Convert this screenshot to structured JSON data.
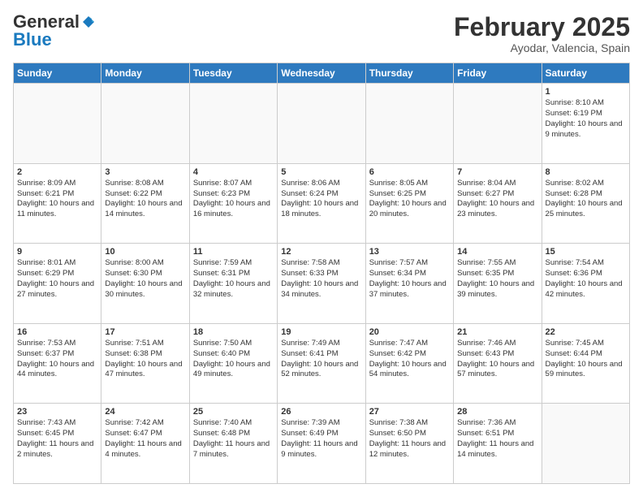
{
  "header": {
    "logo_general": "General",
    "logo_blue": "Blue",
    "month_title": "February 2025",
    "location": "Ayodar, Valencia, Spain"
  },
  "days_of_week": [
    "Sunday",
    "Monday",
    "Tuesday",
    "Wednesday",
    "Thursday",
    "Friday",
    "Saturday"
  ],
  "weeks": [
    [
      {
        "day": "",
        "info": ""
      },
      {
        "day": "",
        "info": ""
      },
      {
        "day": "",
        "info": ""
      },
      {
        "day": "",
        "info": ""
      },
      {
        "day": "",
        "info": ""
      },
      {
        "day": "",
        "info": ""
      },
      {
        "day": "1",
        "info": "Sunrise: 8:10 AM\nSunset: 6:19 PM\nDaylight: 10 hours and 9 minutes."
      }
    ],
    [
      {
        "day": "2",
        "info": "Sunrise: 8:09 AM\nSunset: 6:21 PM\nDaylight: 10 hours and 11 minutes."
      },
      {
        "day": "3",
        "info": "Sunrise: 8:08 AM\nSunset: 6:22 PM\nDaylight: 10 hours and 14 minutes."
      },
      {
        "day": "4",
        "info": "Sunrise: 8:07 AM\nSunset: 6:23 PM\nDaylight: 10 hours and 16 minutes."
      },
      {
        "day": "5",
        "info": "Sunrise: 8:06 AM\nSunset: 6:24 PM\nDaylight: 10 hours and 18 minutes."
      },
      {
        "day": "6",
        "info": "Sunrise: 8:05 AM\nSunset: 6:25 PM\nDaylight: 10 hours and 20 minutes."
      },
      {
        "day": "7",
        "info": "Sunrise: 8:04 AM\nSunset: 6:27 PM\nDaylight: 10 hours and 23 minutes."
      },
      {
        "day": "8",
        "info": "Sunrise: 8:02 AM\nSunset: 6:28 PM\nDaylight: 10 hours and 25 minutes."
      }
    ],
    [
      {
        "day": "9",
        "info": "Sunrise: 8:01 AM\nSunset: 6:29 PM\nDaylight: 10 hours and 27 minutes."
      },
      {
        "day": "10",
        "info": "Sunrise: 8:00 AM\nSunset: 6:30 PM\nDaylight: 10 hours and 30 minutes."
      },
      {
        "day": "11",
        "info": "Sunrise: 7:59 AM\nSunset: 6:31 PM\nDaylight: 10 hours and 32 minutes."
      },
      {
        "day": "12",
        "info": "Sunrise: 7:58 AM\nSunset: 6:33 PM\nDaylight: 10 hours and 34 minutes."
      },
      {
        "day": "13",
        "info": "Sunrise: 7:57 AM\nSunset: 6:34 PM\nDaylight: 10 hours and 37 minutes."
      },
      {
        "day": "14",
        "info": "Sunrise: 7:55 AM\nSunset: 6:35 PM\nDaylight: 10 hours and 39 minutes."
      },
      {
        "day": "15",
        "info": "Sunrise: 7:54 AM\nSunset: 6:36 PM\nDaylight: 10 hours and 42 minutes."
      }
    ],
    [
      {
        "day": "16",
        "info": "Sunrise: 7:53 AM\nSunset: 6:37 PM\nDaylight: 10 hours and 44 minutes."
      },
      {
        "day": "17",
        "info": "Sunrise: 7:51 AM\nSunset: 6:38 PM\nDaylight: 10 hours and 47 minutes."
      },
      {
        "day": "18",
        "info": "Sunrise: 7:50 AM\nSunset: 6:40 PM\nDaylight: 10 hours and 49 minutes."
      },
      {
        "day": "19",
        "info": "Sunrise: 7:49 AM\nSunset: 6:41 PM\nDaylight: 10 hours and 52 minutes."
      },
      {
        "day": "20",
        "info": "Sunrise: 7:47 AM\nSunset: 6:42 PM\nDaylight: 10 hours and 54 minutes."
      },
      {
        "day": "21",
        "info": "Sunrise: 7:46 AM\nSunset: 6:43 PM\nDaylight: 10 hours and 57 minutes."
      },
      {
        "day": "22",
        "info": "Sunrise: 7:45 AM\nSunset: 6:44 PM\nDaylight: 10 hours and 59 minutes."
      }
    ],
    [
      {
        "day": "23",
        "info": "Sunrise: 7:43 AM\nSunset: 6:45 PM\nDaylight: 11 hours and 2 minutes."
      },
      {
        "day": "24",
        "info": "Sunrise: 7:42 AM\nSunset: 6:47 PM\nDaylight: 11 hours and 4 minutes."
      },
      {
        "day": "25",
        "info": "Sunrise: 7:40 AM\nSunset: 6:48 PM\nDaylight: 11 hours and 7 minutes."
      },
      {
        "day": "26",
        "info": "Sunrise: 7:39 AM\nSunset: 6:49 PM\nDaylight: 11 hours and 9 minutes."
      },
      {
        "day": "27",
        "info": "Sunrise: 7:38 AM\nSunset: 6:50 PM\nDaylight: 11 hours and 12 minutes."
      },
      {
        "day": "28",
        "info": "Sunrise: 7:36 AM\nSunset: 6:51 PM\nDaylight: 11 hours and 14 minutes."
      },
      {
        "day": "",
        "info": ""
      }
    ]
  ]
}
